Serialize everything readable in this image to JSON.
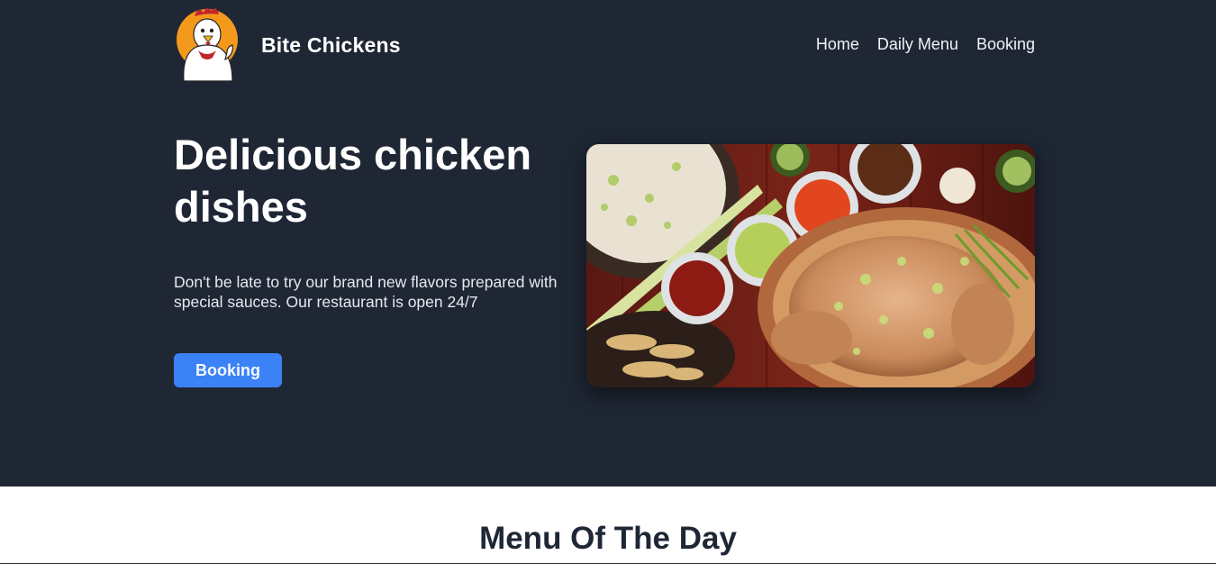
{
  "brand": {
    "name": "Bite Chickens",
    "logo_icon": "rooster-mascot-icon"
  },
  "nav": {
    "items": [
      "Home",
      "Daily Menu",
      "Booking"
    ]
  },
  "hero": {
    "headline": "Delicious chicken dishes",
    "lead": "Don't be late to try our brand new flavors prepared with special sauces. Our restaurant is open 24/7",
    "cta_label": "Booking",
    "image_icon": "roast-chicken-platter-image"
  },
  "menu_section": {
    "title": "Menu Of The Day"
  },
  "colors": {
    "hero_bg": "#1f2735",
    "accent": "#3b82f6",
    "page_bg": "#ffffff"
  }
}
